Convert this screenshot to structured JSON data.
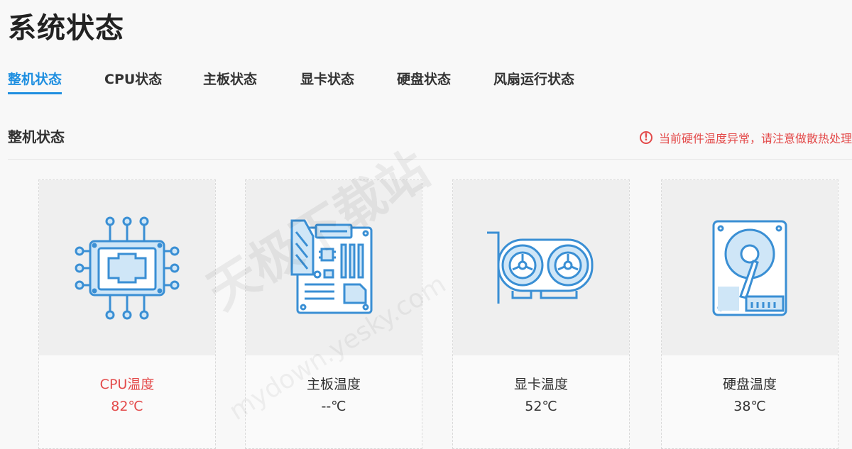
{
  "page": {
    "title": "系统状态"
  },
  "tabs": [
    {
      "label": "整机状态",
      "active": true
    },
    {
      "label": "CPU状态",
      "active": false
    },
    {
      "label": "主板状态",
      "active": false
    },
    {
      "label": "显卡状态",
      "active": false
    },
    {
      "label": "硬盘状态",
      "active": false
    },
    {
      "label": "风扇运行状态",
      "active": false
    }
  ],
  "section": {
    "title": "整机状态",
    "alert": {
      "icon": "exclamation-circle-icon",
      "text": "当前硬件温度异常，请注意做散热处理",
      "color": "#e34a4a"
    }
  },
  "cards": [
    {
      "icon": "cpu-chip-icon",
      "label": "CPU温度",
      "value": "82℃",
      "warning": true
    },
    {
      "icon": "motherboard-icon",
      "label": "主板温度",
      "value": "--℃",
      "warning": false
    },
    {
      "icon": "graphics-card-icon",
      "label": "显卡温度",
      "value": "52℃",
      "warning": false
    },
    {
      "icon": "hard-disk-icon",
      "label": "硬盘温度",
      "value": "38℃",
      "warning": false
    }
  ],
  "watermark": {
    "text": "天极下载站",
    "url_text": "mydown.yesky.com"
  },
  "colors": {
    "accent": "#1f8fe0",
    "warning": "#e34a4a",
    "icon_stroke": "#3a8fd4",
    "icon_fill": "#cfe6f7"
  }
}
